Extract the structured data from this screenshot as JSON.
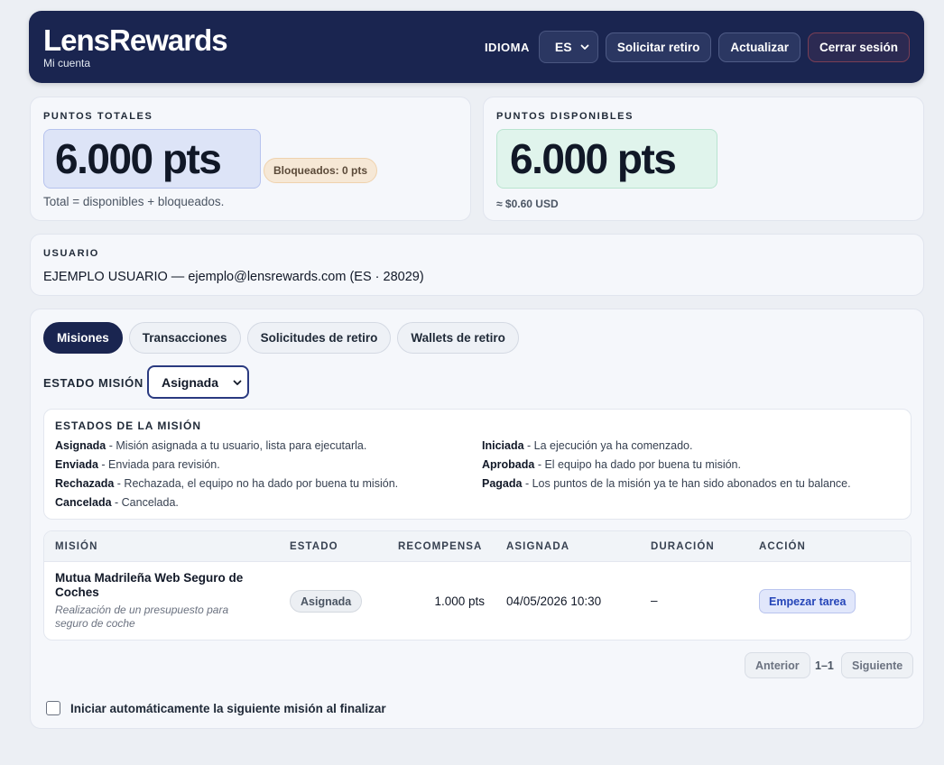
{
  "header": {
    "brand": "LensRewards",
    "subtitle": "Mi cuenta",
    "language_label": "IDIOMA",
    "language_value": "ES",
    "withdraw_button": "Solicitar retiro",
    "refresh_button": "Actualizar",
    "logout_button": "Cerrar sesión"
  },
  "balance": {
    "total_label": "PUNTOS TOTALES",
    "total_value": "6.000 pts",
    "locked_badge": "Bloqueados: 0 pts",
    "total_note": "Total = disponibles + bloqueados.",
    "available_label": "PUNTOS DISPONIBLES",
    "available_value": "6.000 pts",
    "available_usd": "≈ $0.60 USD"
  },
  "user": {
    "label": "USUARIO",
    "info": "EJEMPLO USUARIO — ejemplo@lensrewards.com (ES · 28029)"
  },
  "tabs": [
    {
      "label": "Misiones",
      "active": true
    },
    {
      "label": "Transacciones",
      "active": false
    },
    {
      "label": "Solicitudes de retiro",
      "active": false
    },
    {
      "label": "Wallets de retiro",
      "active": false
    }
  ],
  "filter": {
    "label": "ESTADO MISIÓN",
    "value": "Asignada"
  },
  "legend": {
    "title": "ESTADOS DE LA MISIÓN",
    "items": [
      {
        "term": "Asignada",
        "desc": " - Misión asignada a tu usuario, lista para ejecutarla."
      },
      {
        "term": "Iniciada",
        "desc": " - La ejecución ya ha comenzado."
      },
      {
        "term": "Enviada",
        "desc": " - Enviada para revisión."
      },
      {
        "term": "Aprobada",
        "desc": " - El equipo ha dado por buena tu misión."
      },
      {
        "term": "Rechazada",
        "desc": " - Rechazada, el equipo no ha dado por buena tu misión."
      },
      {
        "term": "Pagada",
        "desc": " - Los puntos de la misión ya te han sido abonados en tu balance."
      },
      {
        "term": "Cancelada",
        "desc": " - Cancelada."
      }
    ]
  },
  "table": {
    "headers": [
      "MISIÓN",
      "ESTADO",
      "RECOMPENSA",
      "ASIGNADA",
      "DURACIÓN",
      "ACCIÓN"
    ],
    "rows": [
      {
        "title": "Mutua Madrileña Web Seguro de Coches",
        "description": "Realización de un presupuesto para seguro de coche",
        "status": "Asignada",
        "reward": "1.000 pts",
        "assigned": "04/05/2026 10:30",
        "duration": "–",
        "action": "Empezar tarea"
      }
    ]
  },
  "pagination": {
    "prev": "Anterior",
    "range": "1–1",
    "next": "Siguiente"
  },
  "auto_start": {
    "label": "Iniciar automáticamente la siguiente misión al finalizar",
    "checked": false
  }
}
